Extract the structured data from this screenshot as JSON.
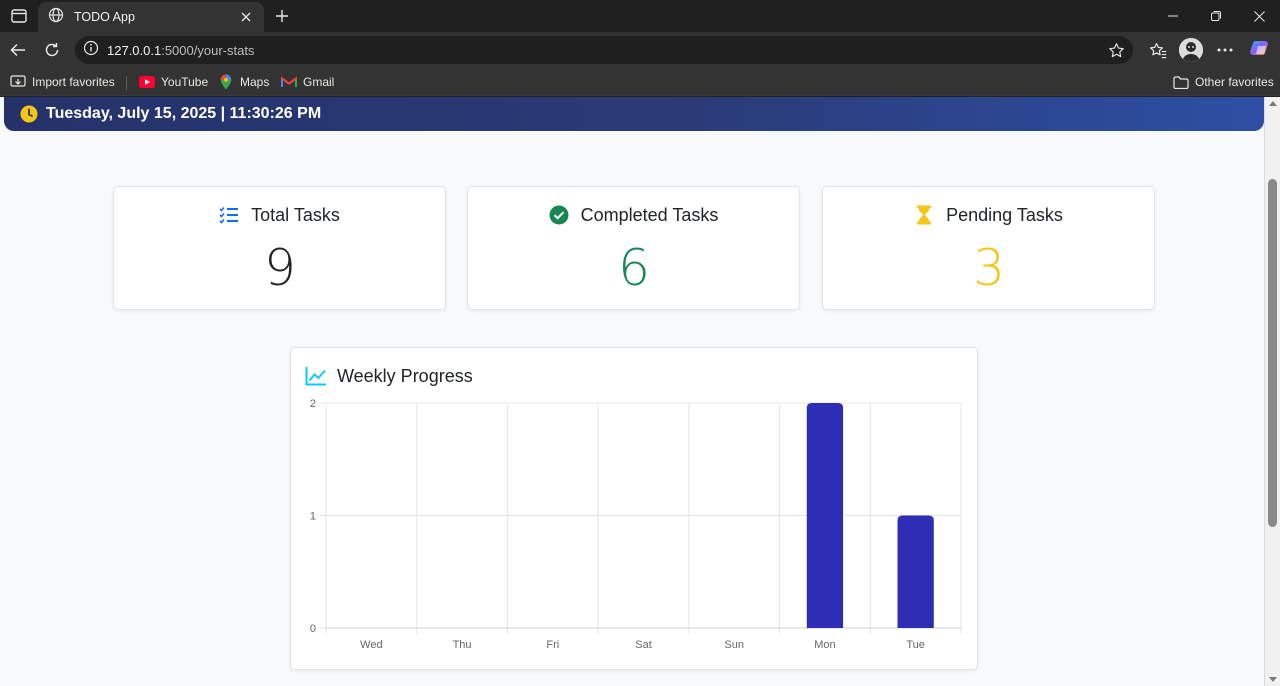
{
  "browser": {
    "tab_title": "TODO App",
    "url_host": "127.0.0.1",
    "url_rest": ":5000/your-stats",
    "bookmarks": {
      "import": "Import favorites",
      "youtube": "YouTube",
      "maps": "Maps",
      "gmail": "Gmail",
      "other": "Other favorites"
    }
  },
  "header": {
    "datetime": "Tuesday, July 15, 2025 | 11:30:26 PM"
  },
  "stats": {
    "total": {
      "label": "Total Tasks",
      "value": "9",
      "color": "#212529"
    },
    "completed": {
      "label": "Completed Tasks",
      "value": "6",
      "color": "#198754"
    },
    "pending": {
      "label": "Pending Tasks",
      "value": "3",
      "color": "#f5c518"
    }
  },
  "chart": {
    "title": "Weekly Progress"
  },
  "chart_data": {
    "type": "bar",
    "categories": [
      "Wed",
      "Thu",
      "Fri",
      "Sat",
      "Sun",
      "Mon",
      "Tue"
    ],
    "values": [
      0,
      0,
      0,
      0,
      0,
      2,
      1
    ],
    "yticks": [
      "0",
      "1",
      "2"
    ],
    "ylim": [
      0,
      2
    ],
    "bar_color": "#2d2db5",
    "grid": true,
    "legend": "none"
  }
}
